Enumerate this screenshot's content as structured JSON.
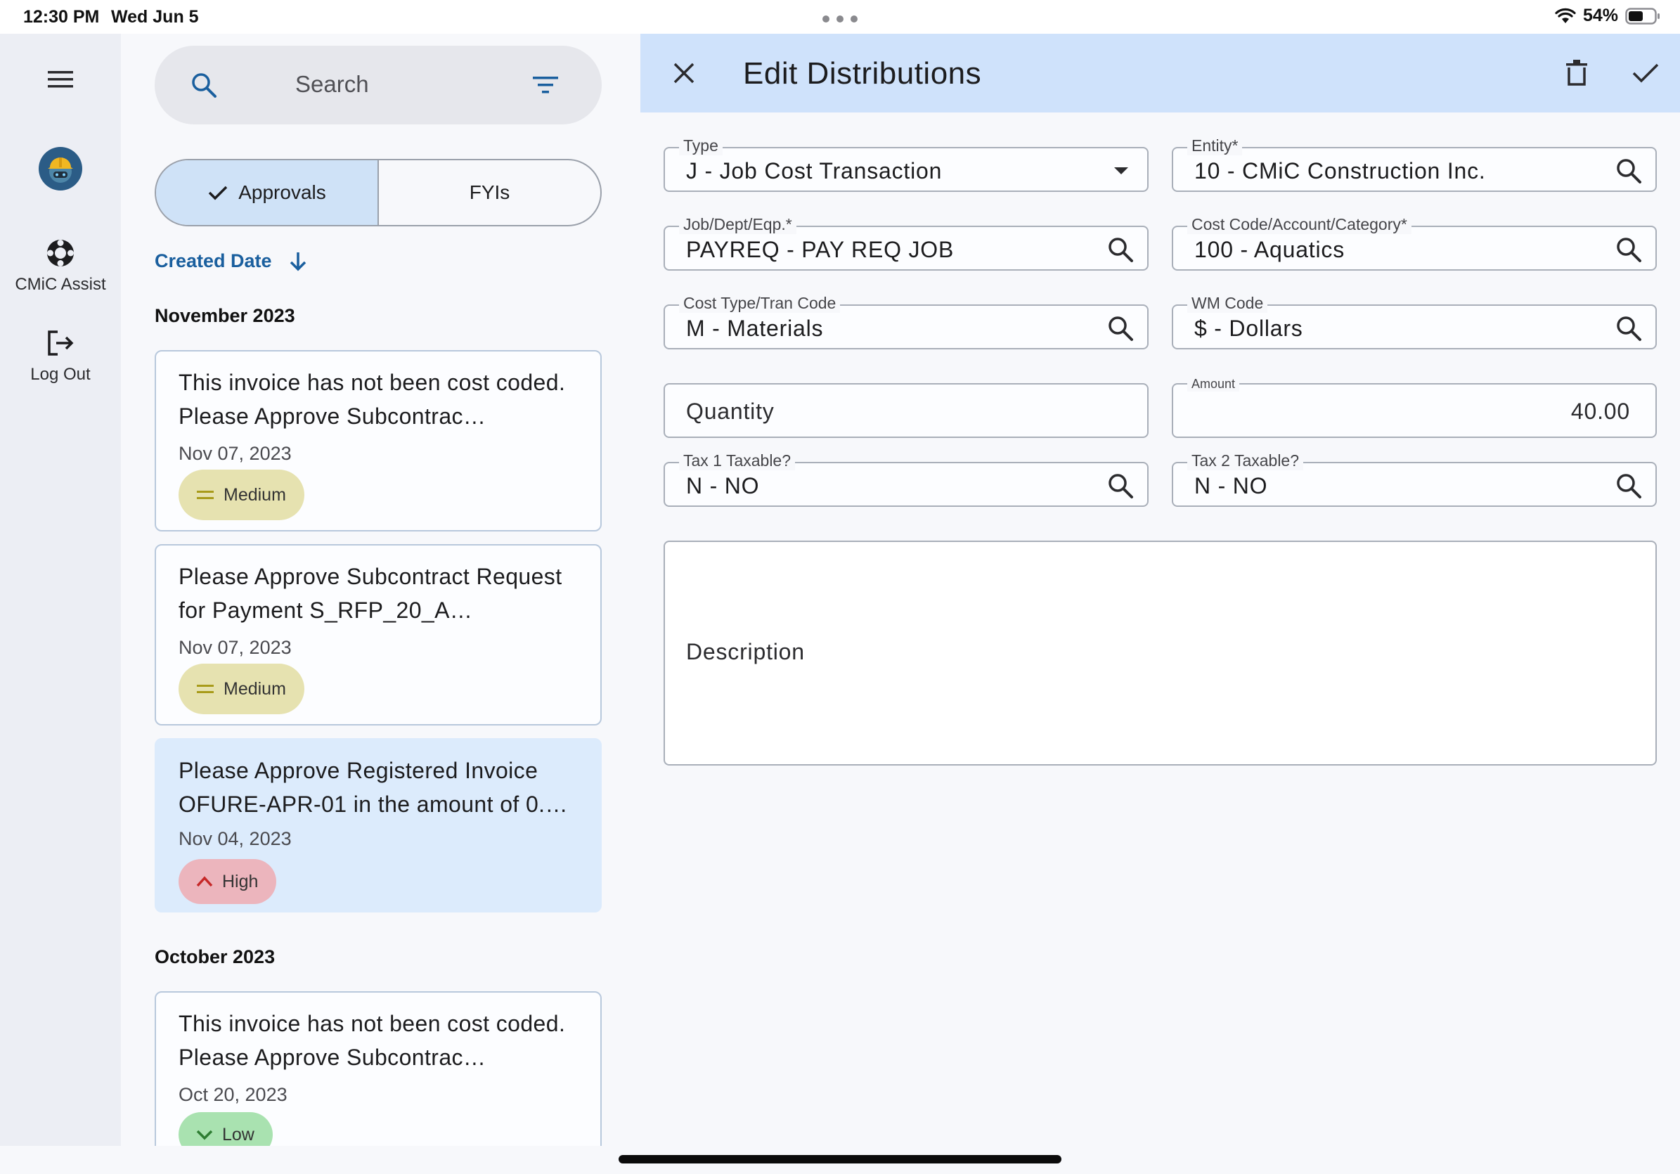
{
  "status_bar": {
    "time": "12:30 PM",
    "date": "Wed Jun 5",
    "battery": "54%"
  },
  "nav": {
    "assist_label": "CMiC Assist",
    "logout_label": "Log Out"
  },
  "list": {
    "search_placeholder": "Search",
    "tabs": [
      {
        "label": "Approvals",
        "selected": true
      },
      {
        "label": "FYIs",
        "selected": false
      }
    ],
    "sort_label": "Created Date",
    "groups": [
      {
        "month": "November 2023",
        "items": [
          {
            "title": "This invoice has not been cost coded. Please Approve Subcontrac…",
            "date": "Nov 07, 2023",
            "priority": "Medium",
            "selected": false
          },
          {
            "title": " Please Approve Subcontract Request for Payment S_RFP_20_A…",
            "date": "Nov 07, 2023",
            "priority": "Medium",
            "selected": false
          },
          {
            "title": " Please Approve Registered Invoice OFURE-APR-01 in the amount of 0.…",
            "date": "Nov 04, 2023",
            "priority": "High",
            "selected": true
          }
        ]
      },
      {
        "month": "October 2023",
        "items": [
          {
            "title": "This invoice has not been cost coded. Please Approve Subcontrac…",
            "date": "Oct 20, 2023",
            "priority": "Low",
            "selected": false
          }
        ]
      }
    ]
  },
  "edit": {
    "title": "Edit Distributions",
    "fields": {
      "type": {
        "label": "Type",
        "value": "J - Job Cost Transaction"
      },
      "entity": {
        "label": "Entity*",
        "value": "10 - CMiC Construction Inc."
      },
      "job": {
        "label": "Job/Dept/Eqp.*",
        "value": "PAYREQ - PAY REQ JOB"
      },
      "cost_code": {
        "label": "Cost Code/Account/Category*",
        "value": "100 - Aquatics"
      },
      "cost_type": {
        "label": "Cost Type/Tran Code",
        "value": "M - Materials"
      },
      "wm_code": {
        "label": "WM Code",
        "value": "$ - Dollars"
      },
      "quantity": {
        "placeholder": "Quantity"
      },
      "amount": {
        "label": "Amount",
        "value": "40.00"
      },
      "tax1": {
        "label": "Tax 1 Taxable?",
        "value": "N - NO"
      },
      "tax2": {
        "label": "Tax 2 Taxable?",
        "value": "N - NO"
      },
      "description": {
        "placeholder": "Description"
      }
    }
  },
  "colors": {
    "header_bg": "#cfe2fb",
    "selected_card_bg": "#dcebfc",
    "accent_blue": "#1a5f9e",
    "medium_badge": "#e6e2b0",
    "high_badge": "#ecb5bd",
    "low_badge": "#a9e2b0"
  }
}
